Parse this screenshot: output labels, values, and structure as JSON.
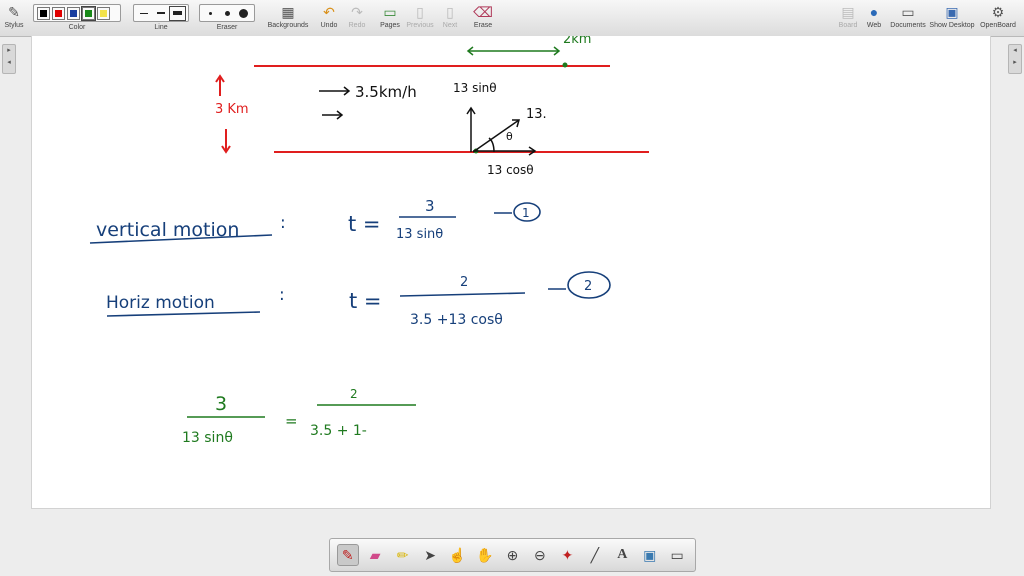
{
  "toolbar": {
    "stylus": "Stylus",
    "color": "Color",
    "line": "Line",
    "eraser": "Eraser",
    "backgrounds": "Backgrounds",
    "undo": "Undo",
    "redo": "Redo",
    "pages": "Pages",
    "previous": "Previous",
    "next": "Next",
    "erase": "Erase",
    "board": "Board",
    "web": "Web",
    "documents": "Documents",
    "show_desktop": "Show Desktop",
    "openboard": "OpenBoard"
  },
  "colors": {
    "swatches": [
      "#000000",
      "#e00000",
      "#1a3fa0",
      "#1a8a1a",
      "#f2e24a"
    ],
    "ink_red": "#e01e1e",
    "ink_blue": "#163f7a",
    "ink_green": "#1f7a1f"
  },
  "board": {
    "top_label": "2km",
    "width_label": "3 Km",
    "river_speed": "3.5km/h",
    "comp_vertical": "13 sinθ",
    "boat_speed": "13.",
    "angle": "θ",
    "comp_horizontal": "13 cosθ",
    "vertical_heading": "vertical motion",
    "colon1": ":",
    "eq1_lhs": "t =",
    "eq1_num": "3",
    "eq1_den": "13 sinθ",
    "eq1_tag": "1",
    "horiz_heading": "Horiz motion",
    "colon2": ":",
    "eq2_lhs": "t =",
    "eq2_num": "2",
    "eq2_den": "3.5 +13 cosθ",
    "eq2_tag": "2",
    "eq3_left_num": "3",
    "eq3_left_den": "13 sinθ",
    "eq3_eq": "=",
    "eq3_right_num": "2",
    "eq3_right_den": "3.5 + 1-"
  },
  "bottom_tools": [
    "pen-icon",
    "eraser-icon",
    "highlighter-icon",
    "pointer-icon",
    "hand-pointer-icon",
    "hand-icon",
    "zoom-in-icon",
    "zoom-out-icon",
    "laser-icon",
    "line-icon",
    "text-icon",
    "capture-icon",
    "whiteboard-icon"
  ]
}
